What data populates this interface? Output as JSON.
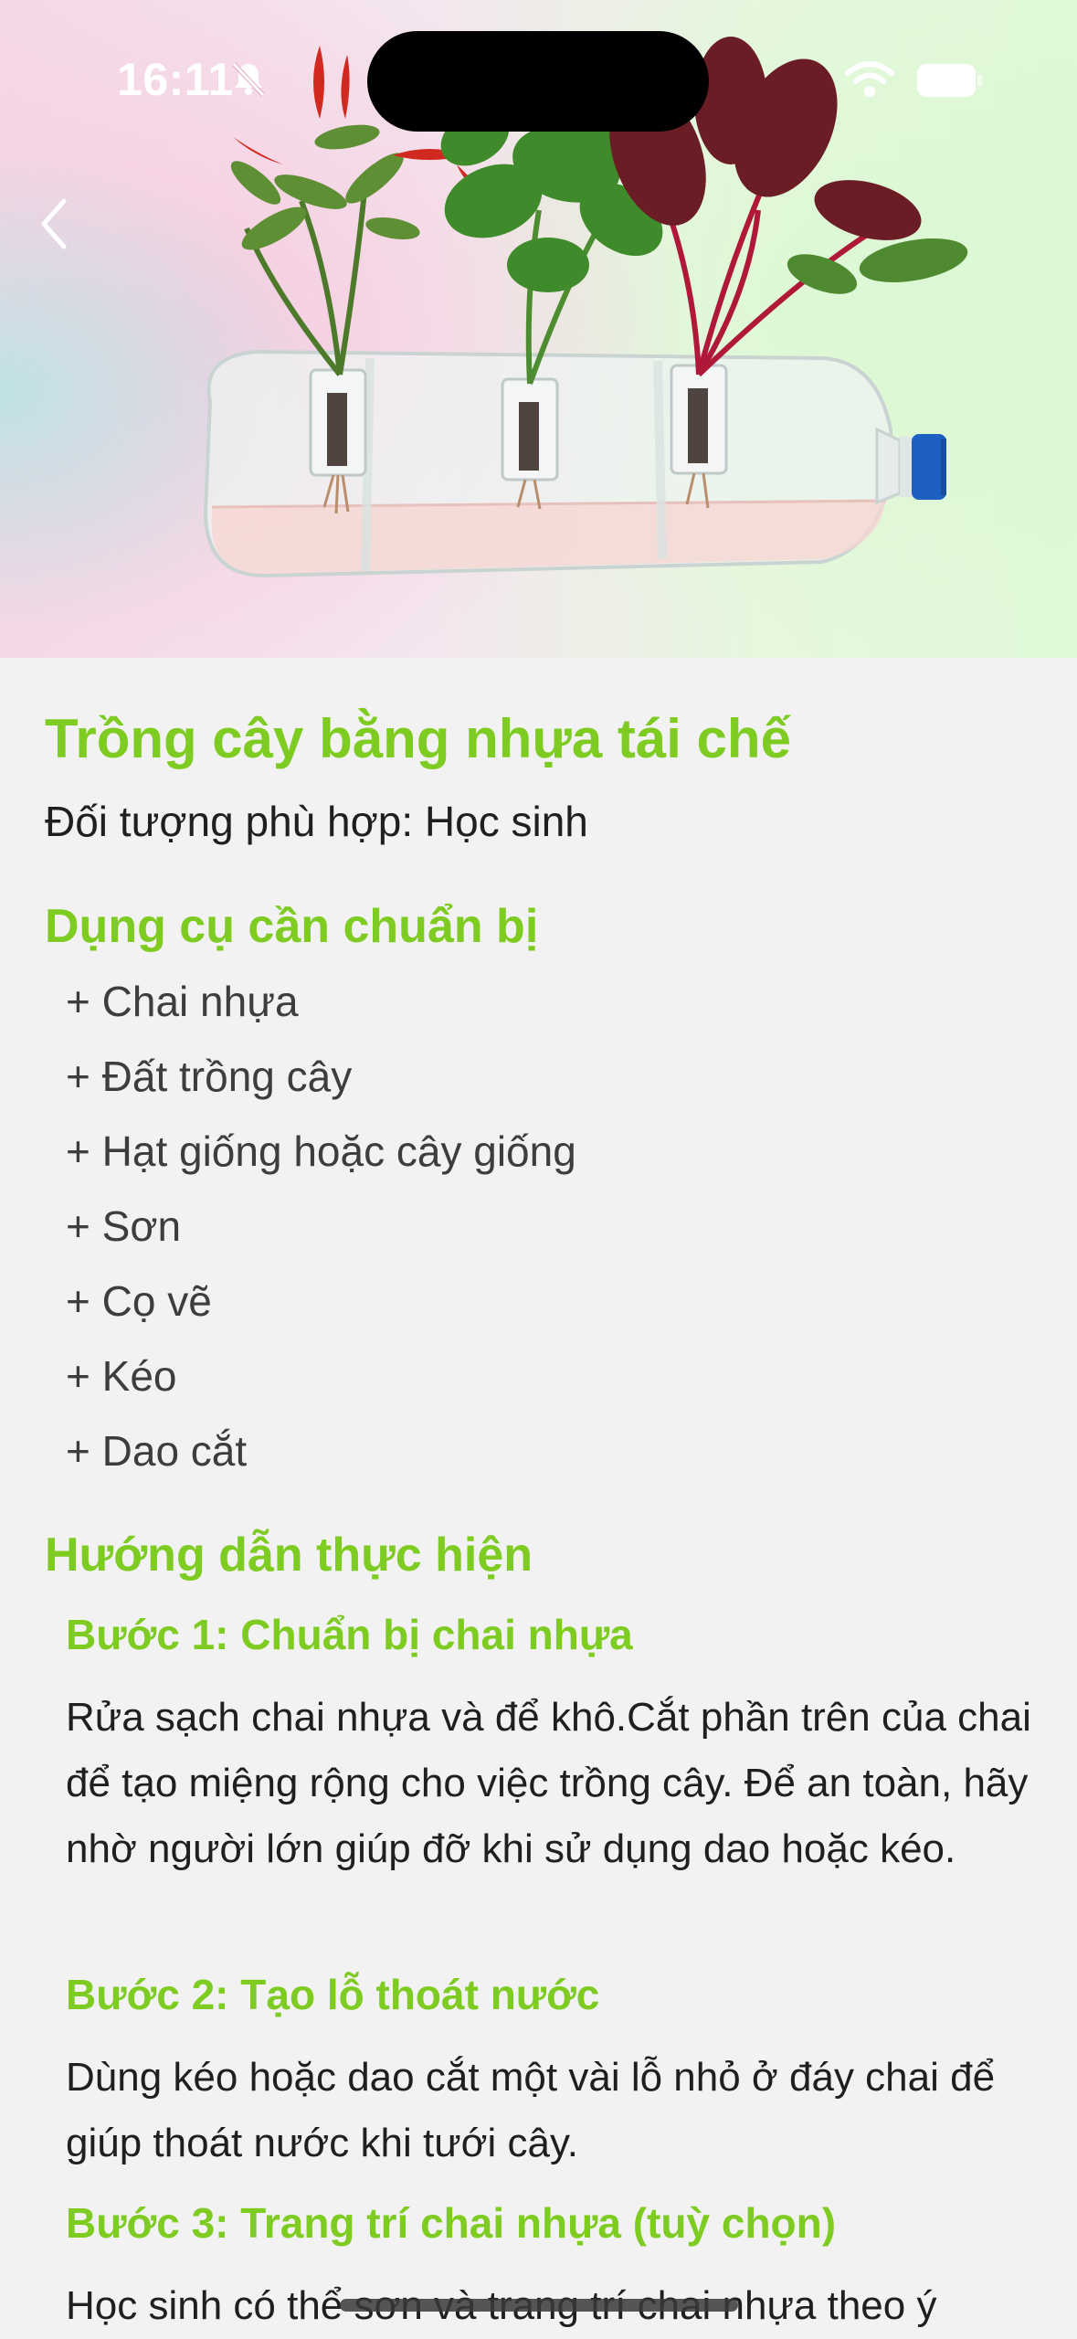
{
  "status_bar": {
    "time": "16:11",
    "icons": [
      "bell-slash-icon",
      "wifi-icon",
      "battery-icon"
    ]
  },
  "header": {
    "back_icon": "chevron-left-icon",
    "hero_image": "plastic-bottle-planter-with-chili-basil-chard-photo"
  },
  "article": {
    "title": "Trồng cây bằng nhựa tái chế",
    "audience": "Đối tượng phù hợp: Học sinh",
    "tools_heading": "Dụng cụ cần chuẩn bị",
    "tools": [
      "+ Chai nhựa",
      "+ Đất trồng cây",
      "+ Hạt giống hoặc cây giống",
      "+ Sơn",
      "+ Cọ vẽ",
      "+ Kéo",
      "+ Dao cắt"
    ],
    "guide_heading": "Hướng dẫn thực hiện",
    "steps": [
      {
        "title": "Bước 1: Chuẩn bị chai nhựa",
        "text": "Rửa sạch chai nhựa và để khô.Cắt phần trên của chai để tạo miệng rộng cho việc trồng cây. Để an toàn, hãy nhờ người lớn giúp đỡ khi sử dụng dao hoặc kéo."
      },
      {
        "title": "Bước 2: Tạo lỗ thoát nước",
        "text": "Dùng kéo hoặc dao cắt một vài lỗ nhỏ ở đáy chai để giúp thoát nước khi tưới cây."
      },
      {
        "title": "Bước 3: Trang trí chai nhựa (tuỳ chọn)",
        "text": "Học sinh có thể sơn và trang trí chai nhựa theo ý"
      }
    ]
  },
  "colors": {
    "accent": "#7ecb22",
    "text": "#1f1f1f",
    "muted_text": "#3d3d3d",
    "background": "#f2f2f2"
  }
}
